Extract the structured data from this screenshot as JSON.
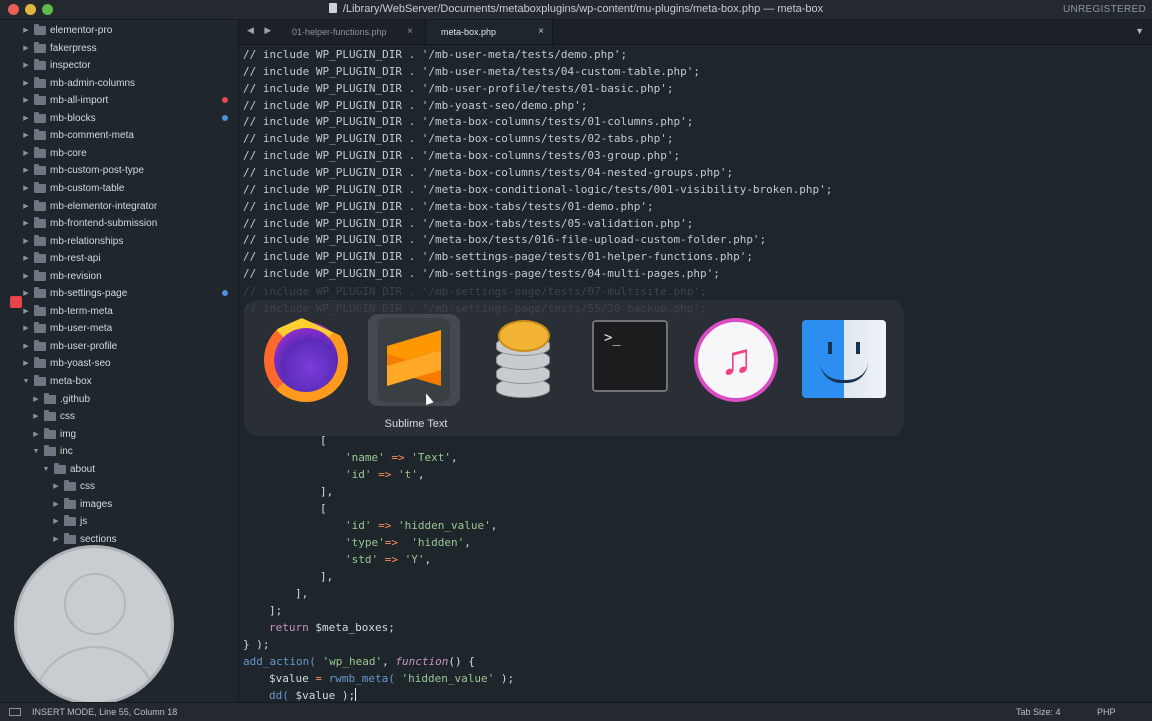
{
  "window": {
    "title": "/Library/WebServer/Documents/metaboxplugins/wp-content/mu-plugins/meta-box.php — meta-box",
    "license": "UNREGISTERED"
  },
  "sidebar": {
    "items": [
      {
        "label": "elementor-pro",
        "depth": 0,
        "open": false
      },
      {
        "label": "fakerpress",
        "depth": 0,
        "open": false
      },
      {
        "label": "inspector",
        "depth": 0,
        "open": false
      },
      {
        "label": "mb-admin-columns",
        "depth": 0,
        "open": false
      },
      {
        "label": "mb-all-import",
        "depth": 0,
        "open": false,
        "status": "red"
      },
      {
        "label": "mb-blocks",
        "depth": 0,
        "open": false,
        "status": "blue"
      },
      {
        "label": "mb-comment-meta",
        "depth": 0,
        "open": false
      },
      {
        "label": "mb-core",
        "depth": 0,
        "open": false
      },
      {
        "label": "mb-custom-post-type",
        "depth": 0,
        "open": false
      },
      {
        "label": "mb-custom-table",
        "depth": 0,
        "open": false
      },
      {
        "label": "mb-elementor-integrator",
        "depth": 0,
        "open": false
      },
      {
        "label": "mb-frontend-submission",
        "depth": 0,
        "open": false
      },
      {
        "label": "mb-relationships",
        "depth": 0,
        "open": false
      },
      {
        "label": "mb-rest-api",
        "depth": 0,
        "open": false
      },
      {
        "label": "mb-revision",
        "depth": 0,
        "open": false
      },
      {
        "label": "mb-settings-page",
        "depth": 0,
        "open": false,
        "status": "blue"
      },
      {
        "label": "mb-term-meta",
        "depth": 0,
        "open": false
      },
      {
        "label": "mb-user-meta",
        "depth": 0,
        "open": false
      },
      {
        "label": "mb-user-profile",
        "depth": 0,
        "open": false
      },
      {
        "label": "mb-yoast-seo",
        "depth": 0,
        "open": false
      },
      {
        "label": "meta-box",
        "depth": 0,
        "open": true
      },
      {
        "label": ".github",
        "depth": 1,
        "open": false
      },
      {
        "label": "css",
        "depth": 1,
        "open": false
      },
      {
        "label": "img",
        "depth": 1,
        "open": false
      },
      {
        "label": "inc",
        "depth": 1,
        "open": true
      },
      {
        "label": "about",
        "depth": 2,
        "open": true
      },
      {
        "label": "css",
        "depth": 3,
        "open": false
      },
      {
        "label": "images",
        "depth": 3,
        "open": false
      },
      {
        "label": "js",
        "depth": 3,
        "open": false
      },
      {
        "label": "sections",
        "depth": 3,
        "open": false
      }
    ]
  },
  "tabs": [
    {
      "label": "01-helper-functions.php",
      "close": "×"
    },
    {
      "label": "meta-box.php",
      "close": "×"
    }
  ],
  "editor": {
    "include_lines": [
      "// include WP_PLUGIN_DIR . '/mb-user-meta/tests/demo.php';",
      "// include WP_PLUGIN_DIR . '/mb-user-meta/tests/04-custom-table.php';",
      "// include WP_PLUGIN_DIR . '/mb-user-profile/tests/01-basic.php';",
      "// include WP_PLUGIN_DIR . '/mb-yoast-seo/demo.php';",
      "// include WP_PLUGIN_DIR . '/meta-box-columns/tests/01-columns.php';",
      "// include WP_PLUGIN_DIR . '/meta-box-columns/tests/02-tabs.php';",
      "// include WP_PLUGIN_DIR . '/meta-box-columns/tests/03-group.php';",
      "// include WP_PLUGIN_DIR . '/meta-box-columns/tests/04-nested-groups.php';",
      "// include WP_PLUGIN_DIR . '/meta-box-conditional-logic/tests/001-visibility-broken.php';",
      "// include WP_PLUGIN_DIR . '/meta-box-tabs/tests/01-demo.php';",
      "// include WP_PLUGIN_DIR . '/meta-box-tabs/tests/05-validation.php';",
      "// include WP_PLUGIN_DIR . '/meta-box/tests/016-file-upload-custom-folder.php';",
      "// include WP_PLUGIN_DIR . '/mb-settings-page/tests/01-helper-functions.php';",
      "// include WP_PLUGIN_DIR . '/mb-settings-page/tests/04-multi-pages.php';"
    ],
    "code": {
      "open_bracket": "[",
      "name_key": "'name'",
      "name_val": "'Text'",
      "id_key": "'id'",
      "id_val": "'t'",
      "close_item": "],",
      "open_bracket2": "[",
      "id2_key": "'id'",
      "id2_val": "'hidden_value'",
      "type_key": "'type'",
      "type_val": "'hidden'",
      "std_key": "'std'",
      "std_val": "'Y'",
      "close_item2": "],",
      "close_fields": "],",
      "close_box": "];",
      "return_kw": "return",
      "return_var": "$meta_boxes",
      "close_fn": "} );",
      "add_action": "add_action(",
      "hook": "'wp_head'",
      "function_kw": "function",
      "fn_tail": "() {",
      "value_var": "$value",
      "rwmb": "rwmb_meta(",
      "rwmb_arg": "'hidden_value'",
      "rwmb_tail": ");",
      "dd": "dd(",
      "dd_arg": "$value",
      "dd_tail": ");"
    }
  },
  "app_switcher": {
    "apps": [
      {
        "name": "Firefox",
        "icon": "firefox-icon"
      },
      {
        "name": "Sublime Text",
        "icon": "sublime-text-icon"
      },
      {
        "name": "Sequel Pro",
        "icon": "sequel-pro-icon"
      },
      {
        "name": "Terminal",
        "icon": "terminal-icon"
      },
      {
        "name": "Music",
        "icon": "music-icon"
      },
      {
        "name": "Finder",
        "icon": "finder-icon"
      }
    ],
    "selected_caption": "Sublime Text",
    "terminal_prompt": ">_"
  },
  "statusbar": {
    "mode": "INSERT MODE, Line 55, Column 18",
    "tab_size": "Tab Size: 4",
    "language": "PHP"
  },
  "colors": {
    "red_status": "#e0474f",
    "blue_status": "#4f8fe0"
  }
}
